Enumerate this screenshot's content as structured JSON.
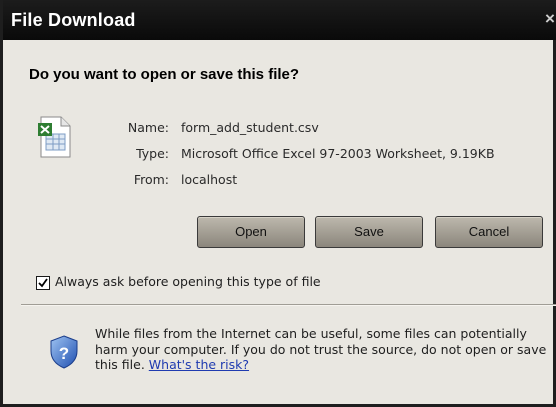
{
  "window": {
    "title": "File Download",
    "close_glyph": "×"
  },
  "question": "Do you want to open or save this file?",
  "file": {
    "icon": "excel-file-icon",
    "name_label": "Name:",
    "name_value": "form_add_student.csv",
    "type_label": "Type:",
    "type_value": "Microsoft Office Excel 97-2003 Worksheet, 9.19KB",
    "from_label": "From:",
    "from_value": "localhost"
  },
  "buttons": {
    "open": "Open",
    "save": "Save",
    "cancel": "Cancel"
  },
  "always_ask": {
    "checked": true,
    "label": "Always ask before opening this type of file"
  },
  "warning": {
    "icon": "security-shield-question-icon",
    "text": "While files from the Internet can be useful, some files can potentially harm your computer. If you do not trust the source, do not open or save this file.",
    "link": "What's the risk?"
  }
}
